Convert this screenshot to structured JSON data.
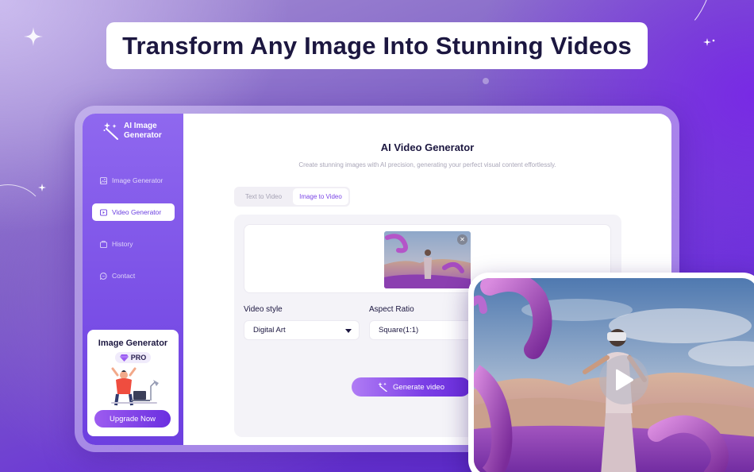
{
  "headline": "Transform Any Image Into Stunning Videos",
  "app": {
    "logo_text": "AI Image Generator",
    "nav": [
      {
        "label": "Image Generator",
        "icon": "image-icon",
        "active": false
      },
      {
        "label": "Video Generator",
        "icon": "video-icon",
        "active": true
      },
      {
        "label": "History",
        "icon": "history-icon",
        "active": false
      },
      {
        "label": "Contact",
        "icon": "chat-icon",
        "active": false
      }
    ],
    "promo": {
      "title": "Image Generator",
      "badge": "PRO",
      "button": "Upgrade Now"
    }
  },
  "main": {
    "title": "AI Video Generator",
    "subtitle": "Create stunning images with AI precision, generating your perfect visual content effortlessly.",
    "tabs": [
      {
        "label": "Text to Video",
        "active": false
      },
      {
        "label": "Image to Video",
        "active": true
      }
    ],
    "video_style": {
      "label": "Video style",
      "value": "Digital Art"
    },
    "aspect_ratio": {
      "label": "Aspect Ratio",
      "value": "Square(1:1)"
    },
    "generate_button": "Generate video"
  },
  "colors": {
    "accent": "#7a45e6",
    "sidebar": "#7a4fe6",
    "headline_text": "#1c1740"
  }
}
